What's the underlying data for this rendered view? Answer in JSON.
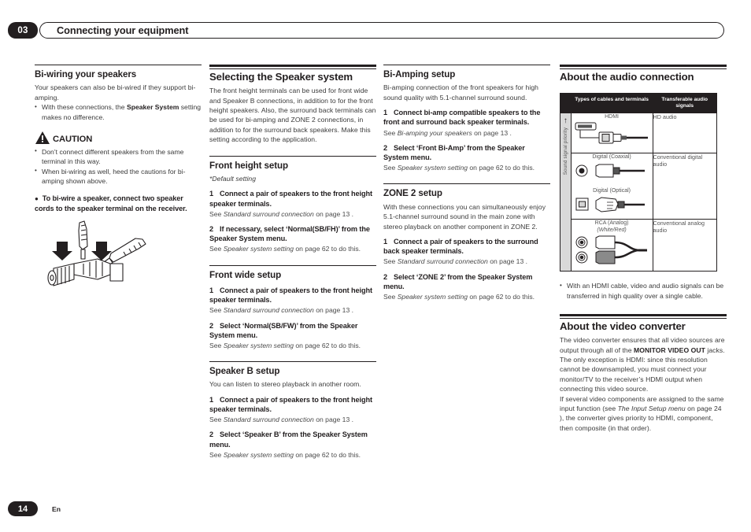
{
  "header": {
    "chapter_number": "03",
    "title": "Connecting your equipment"
  },
  "footer": {
    "page_number": "14",
    "language": "En"
  },
  "col1": {
    "heading": "Bi-wiring your speakers",
    "intro": "Your speakers can also be bi-wired if they support bi-amping.",
    "bullet1_pre": "With these connections, the ",
    "bullet1_bold": "Speaker System",
    "bullet1_post": " setting makes no difference.",
    "caution_label": "CAUTION",
    "caution_bullets": [
      "Don’t connect different speakers from the same terminal in this way.",
      "When bi-wiring as well, heed the cautions for bi-amping shown above."
    ],
    "big_bullet": "To bi-wire a speaker, connect two speaker cords to the speaker terminal on the receiver.",
    "illustration_name": "speaker-terminal-bi-wiring-illustration"
  },
  "col2": {
    "heading": "Selecting the Speaker system",
    "intro": "The front height terminals can be used for front wide and Speaker B connections, in addition to for the front height speakers. Also, the surround back terminals can be used for bi-amping and ZONE 2 connections, in addition to for the surround back speakers. Make this setting according to the application.",
    "sections": [
      {
        "title": "Front height setup",
        "note": "*Default setting",
        "steps": [
          {
            "num": "1",
            "text": "Connect a pair of speakers to the front height speaker terminals.",
            "ref_pre": "See ",
            "ref_ital": "Standard surround connection",
            "ref_post": " on page 13 ."
          },
          {
            "num": "2",
            "text": "If necessary, select ‘Normal(SB/FH)’ from the Speaker System menu.",
            "ref_pre": "See ",
            "ref_ital": "Speaker system setting",
            "ref_post": " on page 62 to do this."
          }
        ]
      },
      {
        "title": "Front wide setup",
        "note": "",
        "steps": [
          {
            "num": "1",
            "text": "Connect a pair of speakers to the front height speaker terminals.",
            "ref_pre": "See ",
            "ref_ital": "Standard surround connection",
            "ref_post": " on page 13 ."
          },
          {
            "num": "2",
            "text": "Select ‘Normal(SB/FW)’ from the Speaker System menu.",
            "ref_pre": "See ",
            "ref_ital": "Speaker system setting",
            "ref_post": " on page 62 to do this."
          }
        ]
      },
      {
        "title": "Speaker B setup",
        "note": "You can listen to stereo playback in another room.",
        "steps": [
          {
            "num": "1",
            "text": "Connect a pair of speakers to the front height speaker terminals.",
            "ref_pre": "See ",
            "ref_ital": "Standard surround connection",
            "ref_post": " on page 13 ."
          },
          {
            "num": "2",
            "text": "Select ‘Speaker B’ from the Speaker System menu.",
            "ref_pre": "See ",
            "ref_ital": "Speaker system setting",
            "ref_post": " on page 62 to do this."
          }
        ]
      }
    ]
  },
  "col3": {
    "sections": [
      {
        "title": "Bi-Amping setup",
        "intro": "Bi-amping connection of the front speakers for high sound quality with 5.1-channel surround sound.",
        "steps": [
          {
            "num": "1",
            "text": "Connect bi-amp compatible speakers to the front and surround back speaker terminals.",
            "ref_pre": "See ",
            "ref_ital": "Bi-amping your speakers",
            "ref_post": " on page 13 ."
          },
          {
            "num": "2",
            "text": "Select ‘Front Bi-Amp’ from the Speaker System menu.",
            "ref_pre": "See ",
            "ref_ital": "Speaker system setting",
            "ref_post": " on page 62 to do this."
          }
        ]
      },
      {
        "title": "ZONE 2 setup",
        "intro": "With these connections you can simultaneously enjoy 5.1-channel surround sound in the main zone with stereo playback on another component in ZONE 2.",
        "steps": [
          {
            "num": "1",
            "text": "Connect a pair of speakers to the surround back speaker terminals.",
            "ref_pre": "See ",
            "ref_ital": "Standard surround connection",
            "ref_post": " on page 13 ."
          },
          {
            "num": "2",
            "text": "Select ‘ZONE 2’ from the Speaker System menu.",
            "ref_pre": "See ",
            "ref_ital": "Speaker system setting",
            "ref_post": " on page 62 to do this."
          }
        ]
      }
    ]
  },
  "col4": {
    "audio_heading": "About the audio connection",
    "table": {
      "side_label": "Sound signal priority",
      "side_arrow": "↑",
      "columns": [
        "Types of cables and terminals",
        "Transferable audio signals"
      ],
      "rows": [
        {
          "cables": [
            {
              "label": "HDMI",
              "sub": "",
              "icon": "hdmi-cable-icon"
            }
          ],
          "signal": "HD audio"
        },
        {
          "cables": [
            {
              "label": "Digital (Coaxial)",
              "sub": "",
              "icon": "coaxial-cable-icon"
            },
            {
              "label": "Digital (Optical)",
              "sub": "",
              "icon": "optical-cable-icon"
            }
          ],
          "signal": "Conventional digital audio"
        },
        {
          "cables": [
            {
              "label": "RCA (Analog)",
              "sub": "(White/Red)",
              "icon": "rca-cable-icon"
            }
          ],
          "signal": "Conventional analog audio"
        }
      ]
    },
    "audio_bullet": "With an HDMI cable, video and audio signals can be transferred in high quality over a single cable.",
    "video_heading": "About the video converter",
    "video_p1_pre": "The video converter ensures that all video sources are output through all of the ",
    "video_p1_bold": "MONITOR VIDEO OUT",
    "video_p1_post": " jacks. The only exception is HDMI: since this resolution cannot be downsampled, you must connect your monitor/TV to the receiver’s HDMI output when connecting this video source.",
    "video_p2_pre": "If several video components are assigned to the same input function (see ",
    "video_p2_ital": "The Input Setup menu",
    "video_p2_post": " on page 24 ), the converter gives priority to HDMI, component, then composite (in that order)."
  }
}
